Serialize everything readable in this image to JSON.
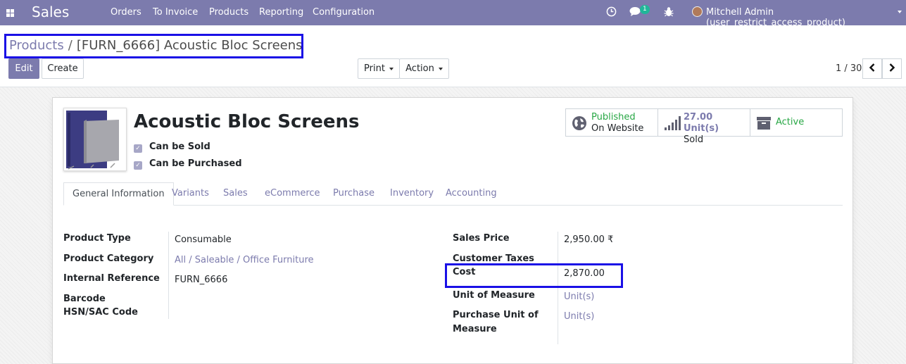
{
  "navbar": {
    "app_name": "Sales",
    "menu": [
      "Orders",
      "To Invoice",
      "Products",
      "Reporting",
      "Configuration"
    ],
    "messages_badge": "1",
    "user": "Mitchell Admin (user_restrict_access_product)"
  },
  "breadcrumb": {
    "parent": "Products",
    "separator": "/",
    "current": "[FURN_6666] Acoustic Bloc Screens"
  },
  "toolbar": {
    "edit_label": "Edit",
    "create_label": "Create",
    "print_label": "Print",
    "action_label": "Action",
    "pager_value": "1 / 30"
  },
  "product": {
    "name": "Acoustic Bloc Screens",
    "can_be_sold_label": "Can be Sold",
    "can_be_purchased_label": "Can be Purchased",
    "can_be_sold": true,
    "can_be_purchased": true
  },
  "stat_buttons": {
    "website": {
      "line1": "Published",
      "line2": "On Website"
    },
    "sold": {
      "value": "27.00 Unit(s)",
      "label": "Sold"
    },
    "active": {
      "label": "Active"
    }
  },
  "tabs": [
    "General Information",
    "Variants",
    "Sales",
    "eCommerce",
    "Purchase",
    "Inventory",
    "Accounting"
  ],
  "general_info": {
    "left": {
      "product_type_label": "Product Type",
      "product_type": "Consumable",
      "product_category_label": "Product Category",
      "product_category": "All / Saleable / Office Furniture",
      "internal_reference_label": "Internal Reference",
      "internal_reference": "FURN_6666",
      "barcode_label": "Barcode",
      "hsn_label": "HSN/SAC Code"
    },
    "right": {
      "sales_price_label": "Sales Price",
      "sales_price": "2,950.00 ₹",
      "customer_taxes_label": "Customer Taxes",
      "cost_label": "Cost",
      "cost": "2,870.00",
      "uom_label": "Unit of Measure",
      "uom": "Unit(s)",
      "purchase_uom_label_1": "Purchase Unit of",
      "purchase_uom_label_2": "Measure",
      "purchase_uom": "Unit(s)"
    }
  },
  "colors": {
    "brand": "#7c7bad",
    "published_green": "#28a745",
    "highlight_blue": "#1a10e6"
  }
}
